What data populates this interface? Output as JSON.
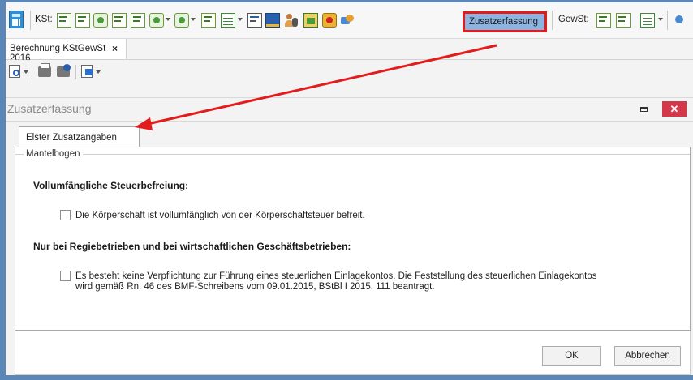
{
  "toolbar": {
    "kst_label": "KSt:",
    "gewst_label": "GewSt:",
    "zusatzerfassung_label": "Zusatzerfassung",
    "icons": [
      "calculator-icon",
      "form-m-icon",
      "form-gk-icon",
      "form-ver-icon",
      "form-z-icon",
      "form-wa-icon",
      "form-aesc-icon",
      "form-aev-icon",
      "form-if-icon",
      "sheets-icon",
      "note-icon",
      "book-icon",
      "people-icon",
      "document-icon",
      "lock-icon",
      "transfer-icon",
      "gewst-m-icon",
      "gewst-zerl-icon",
      "gewst-sheets-icon"
    ]
  },
  "doc_tab": {
    "title": "Berechnung KStGewSt 2016",
    "close": "×"
  },
  "small_toolbar": {
    "icons": [
      "preview-icon",
      "print-icon",
      "print-setup-icon",
      "export-icon"
    ]
  },
  "panel": {
    "title": "Zusatzerfassung",
    "close": "✕"
  },
  "inner_tab": {
    "label": "Elster Zusatzangaben"
  },
  "group": {
    "legend": "Mantelbogen",
    "heading1": "Vollumfängliche Steuerbefreiung:",
    "checkbox1": "Die Körperschaft ist vollumfänglich von der Körperschaftsteuer befreit.",
    "heading2": "Nur bei Regiebetrieben und bei wirtschaftlichen Geschäftsbetrieben:",
    "checkbox2_line1": "Es besteht keine Verpflichtung zur Führung eines steuerlichen Einlagekontos. Die Feststellung des steuerlichen Einlagekontos",
    "checkbox2_line2": "wird gemäß Rn. 46 des BMF-Schreibens vom 09.01.2015, BStBl I 2015, 111 beantragt."
  },
  "footer": {
    "ok": "OK",
    "cancel": "Abbrechen"
  },
  "colors": {
    "highlight": "#e31b1b",
    "frame": "#5b87b8",
    "button_highlight": "#8bb4df"
  }
}
